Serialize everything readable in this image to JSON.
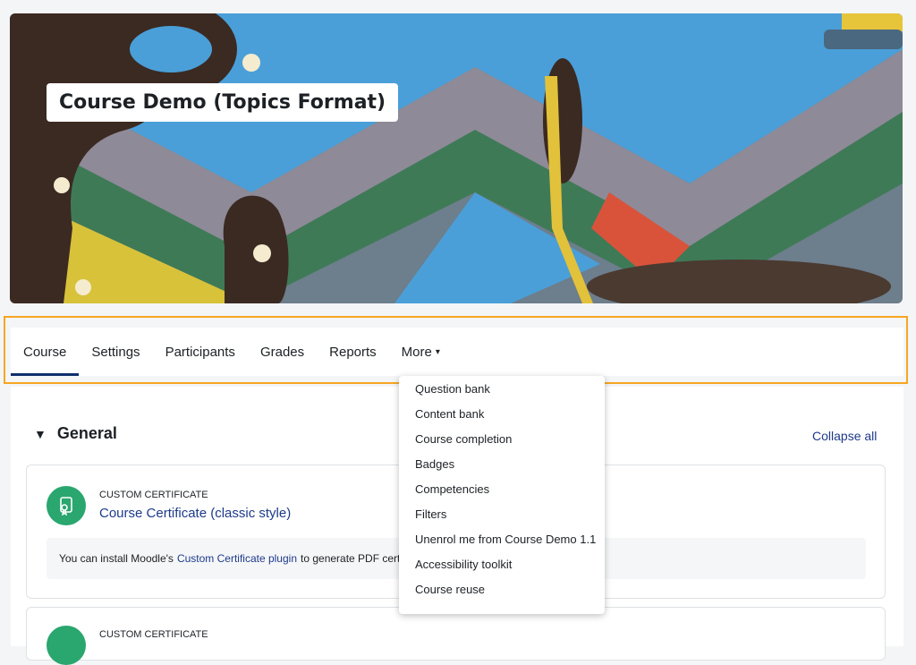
{
  "header": {
    "course_title": "Course Demo (Topics Format)"
  },
  "nav": {
    "tabs": [
      {
        "label": "Course"
      },
      {
        "label": "Settings"
      },
      {
        "label": "Participants"
      },
      {
        "label": "Grades"
      },
      {
        "label": "Reports"
      },
      {
        "label": "More"
      }
    ]
  },
  "more_menu": {
    "items": [
      "Question bank",
      "Content bank",
      "Course completion",
      "Badges",
      "Competencies",
      "Filters",
      "Unenrol me from Course Demo 1.1",
      "Accessibility toolkit",
      "Course reuse"
    ]
  },
  "section": {
    "title": "General",
    "collapse_label": "Collapse all"
  },
  "activities": [
    {
      "type": "CUSTOM CERTIFICATE",
      "name": "Course Certificate (classic style)",
      "note_prefix": "You can install Moodle's",
      "note_link": "Custom Certificate plugin",
      "note_suffix": "to generate PDF certi"
    },
    {
      "type": "CUSTOM CERTIFICATE"
    }
  ],
  "colors": {
    "accent": "#f5a623",
    "activity_icon": "#2aa66f",
    "link": "#1e3a8a"
  }
}
